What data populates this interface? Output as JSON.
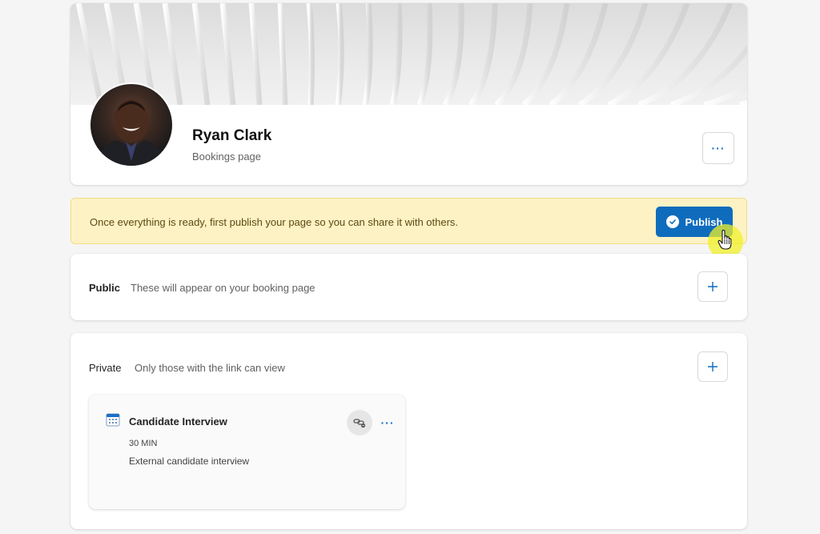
{
  "profile": {
    "name": "Ryan Clark",
    "subtitle": "Bookings page",
    "more_label": "···"
  },
  "notice": {
    "text": "Once everything is ready, first publish your page so you can share it with others.",
    "publish_label": "Publish"
  },
  "sections": {
    "public": {
      "title": "Public",
      "description": "These will appear on your booking page",
      "add_label": "+"
    },
    "private": {
      "title": "Private",
      "description": "Only those with the link can view",
      "add_label": "+",
      "services": [
        {
          "name": "Candidate Interview",
          "duration": "30 MIN",
          "description": "External candidate interview",
          "more_label": "···"
        }
      ]
    }
  },
  "colors": {
    "accent": "#0f6cbd",
    "notice_bg": "#fdf2c4",
    "notice_border": "#f2dc84",
    "page_bg": "#f5f5f5",
    "cursor_highlight": "#f0f028"
  },
  "icons": {
    "profile_more": "more-horizontal-icon",
    "publish": "checkmark-circle-icon",
    "add": "plus-icon",
    "service": "calendar-icon",
    "link": "link-icon",
    "service_more": "more-horizontal-icon",
    "pointer": "hand-pointer-icon"
  }
}
